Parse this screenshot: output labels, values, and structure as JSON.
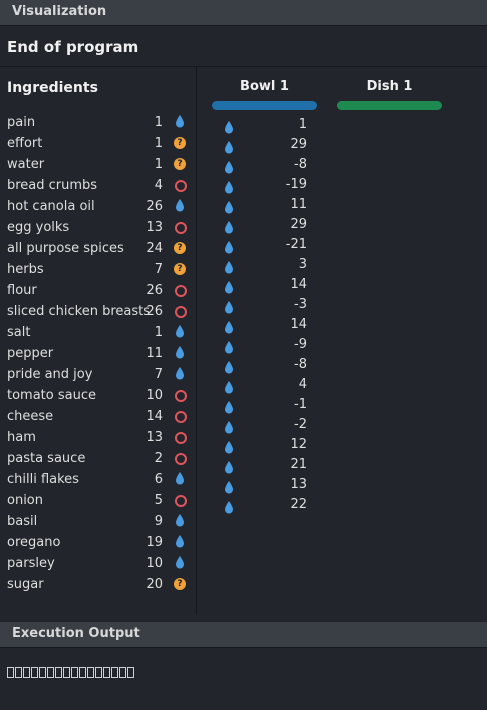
{
  "visualization_title": "Visualization",
  "status": "End of program",
  "ingredients": {
    "title": "Ingredients",
    "items": [
      {
        "name": "pain",
        "value": "1",
        "type": "liquid"
      },
      {
        "name": "effort",
        "value": "1",
        "type": "unknown"
      },
      {
        "name": "water",
        "value": "1",
        "type": "unknown"
      },
      {
        "name": "bread crumbs",
        "value": "4",
        "type": "dry"
      },
      {
        "name": "hot canola oil",
        "value": "26",
        "type": "liquid"
      },
      {
        "name": "egg yolks",
        "value": "13",
        "type": "dry"
      },
      {
        "name": "all purpose spices",
        "value": "24",
        "type": "unknown"
      },
      {
        "name": "herbs",
        "value": "7",
        "type": "unknown"
      },
      {
        "name": "flour",
        "value": "26",
        "type": "dry"
      },
      {
        "name": "sliced chicken breasts",
        "value": "26",
        "type": "dry"
      },
      {
        "name": "salt",
        "value": "1",
        "type": "liquid"
      },
      {
        "name": "pepper",
        "value": "11",
        "type": "liquid"
      },
      {
        "name": "pride and joy",
        "value": "7",
        "type": "liquid"
      },
      {
        "name": "tomato sauce",
        "value": "10",
        "type": "dry"
      },
      {
        "name": "cheese",
        "value": "14",
        "type": "dry"
      },
      {
        "name": "ham",
        "value": "13",
        "type": "dry"
      },
      {
        "name": "pasta sauce",
        "value": "2",
        "type": "dry"
      },
      {
        "name": "chilli flakes",
        "value": "6",
        "type": "liquid"
      },
      {
        "name": "onion",
        "value": "5",
        "type": "dry"
      },
      {
        "name": "basil",
        "value": "9",
        "type": "liquid"
      },
      {
        "name": "oregano",
        "value": "19",
        "type": "liquid"
      },
      {
        "name": "parsley",
        "value": "10",
        "type": "liquid"
      },
      {
        "name": "sugar",
        "value": "20",
        "type": "unknown"
      }
    ]
  },
  "bowl": {
    "title": "Bowl 1",
    "color": "#1f6fa8",
    "values": [
      "1",
      "29",
      "-8",
      "-19",
      "11",
      "29",
      "-21",
      "3",
      "14",
      "-3",
      "14",
      "-9",
      "-8",
      "4",
      "-1",
      "-2",
      "12",
      "21",
      "13",
      "22"
    ]
  },
  "dish": {
    "title": "Dish 1",
    "color": "#1e8a4f"
  },
  "execution_output": {
    "title": "Execution Output",
    "glyph_count": 16
  },
  "colors": {
    "liquid_icon": "#4a9be0",
    "dry_icon": "#e0545c",
    "unknown_icon": "#f0a23a"
  }
}
